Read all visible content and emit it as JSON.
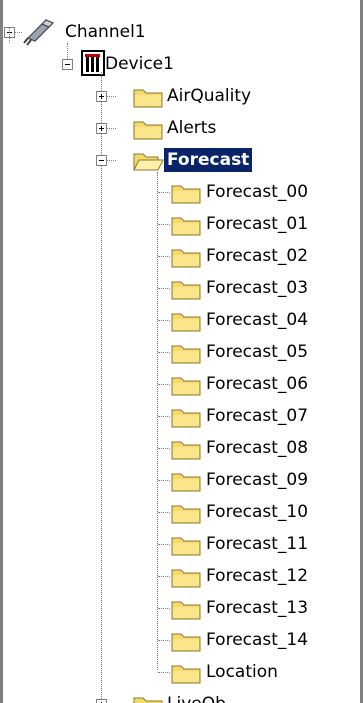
{
  "tree": {
    "channel": {
      "label": "Channel1",
      "icon": "channel-plug-icon"
    },
    "device": {
      "label": "Device1",
      "icon": "device-icon"
    },
    "groups": [
      {
        "label": "AirQuality",
        "expanded": false
      },
      {
        "label": "Alerts",
        "expanded": false
      },
      {
        "label": "Forecast",
        "expanded": true,
        "selected": true
      },
      {
        "label": "LiveOb",
        "expanded": false
      }
    ],
    "forecast_children": [
      "Forecast_00",
      "Forecast_01",
      "Forecast_02",
      "Forecast_03",
      "Forecast_04",
      "Forecast_05",
      "Forecast_06",
      "Forecast_07",
      "Forecast_08",
      "Forecast_09",
      "Forecast_10",
      "Forecast_11",
      "Forecast_12",
      "Forecast_13",
      "Forecast_14",
      "Location"
    ],
    "colors": {
      "selection_bg": "#0a246a",
      "selection_fg": "#ffffff",
      "folder_fill": "#f5d96b",
      "folder_stroke": "#8a7a2a",
      "border": "#808080"
    }
  }
}
